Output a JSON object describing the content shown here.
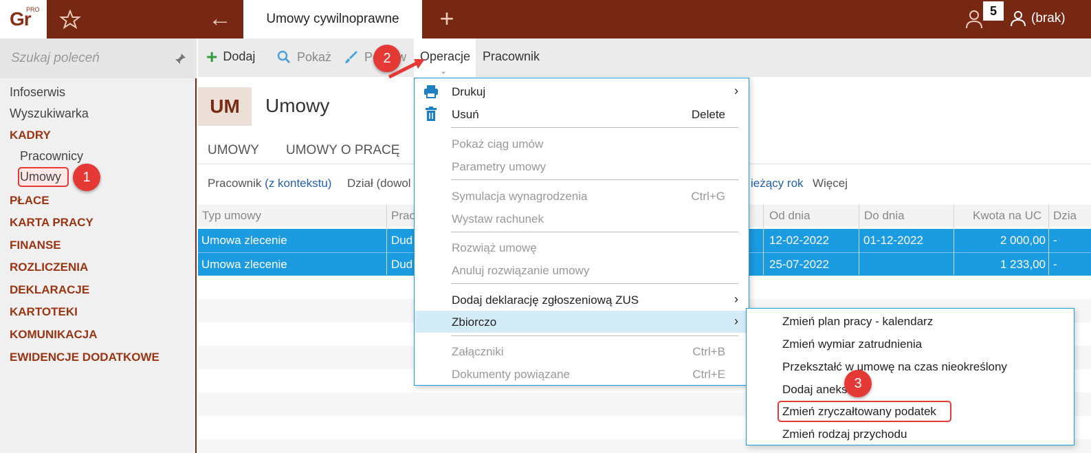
{
  "topbar": {
    "logo_text": "Gr",
    "logo_sup": "PRO",
    "active_tab": "Umowy cywilnoprawne",
    "notifications_count": "5",
    "operator": "(brak)"
  },
  "sidebar": {
    "search_placeholder": "Szukaj poleceń",
    "items": [
      {
        "label": "Infoserwis"
      },
      {
        "label": "Wyszukiwarka"
      },
      {
        "label": "KADRY"
      },
      {
        "label": "Pracownicy"
      },
      {
        "label": "Umowy"
      },
      {
        "label": "PŁACE"
      },
      {
        "label": "KARTA PRACY"
      },
      {
        "label": "FINANSE"
      },
      {
        "label": "ROZLICZENIA"
      },
      {
        "label": "DEKLARACJE"
      },
      {
        "label": "KARTOTEKI"
      },
      {
        "label": "KOMUNIKACJA"
      },
      {
        "label": "EWIDENCJE DODATKOWE"
      }
    ]
  },
  "callouts": {
    "c1": "1",
    "c2": "2",
    "c3": "3"
  },
  "toolbar": {
    "add": "Dodaj",
    "show": "Pokaż",
    "edit": "Popraw",
    "operations": "Operacje",
    "employee": "Pracownik"
  },
  "module": {
    "badge": "UM",
    "title": "Umowy"
  },
  "subtabs": [
    "UMOWY",
    "UMOWY O PRACĘ"
  ],
  "filters": {
    "employee_label": "Pracownik",
    "employee_value": "(z kontekstu)",
    "dept_label": "Dział (dowol",
    "year": "ieżący rok",
    "more": "Więcej"
  },
  "grid": {
    "headers": [
      "Typ umowy",
      "Prac",
      "Od dnia",
      "Do dnia",
      "Kwota na UC",
      "Dzia"
    ],
    "rows": [
      {
        "type": "Umowa zlecenie",
        "employee": "Dud",
        "from": "12-02-2022",
        "to": "01-12-2022",
        "amount": "2 000,00",
        "dept": "-"
      },
      {
        "type": "Umowa zlecenie",
        "employee": "Dud",
        "from": "25-07-2022",
        "to": "",
        "amount": "1 233,00",
        "dept": "-"
      }
    ]
  },
  "menu": {
    "print": "Drukuj",
    "delete": "Usuń",
    "delete_sc": "Delete",
    "chain": "Pokaż ciąg umów",
    "params": "Parametry umowy",
    "sim": "Symulacja wynagrodzenia",
    "sim_sc": "Ctrl+G",
    "invoice": "Wystaw rachunek",
    "terminate": "Rozwiąż umowę",
    "cancel_term": "Anuluj rozwiązanie umowy",
    "zus": "Dodaj deklarację zgłoszeniową ZUS",
    "bulk": "Zbiorczo",
    "attach": "Załączniki",
    "attach_sc": "Ctrl+B",
    "related": "Dokumenty powiązane",
    "related_sc": "Ctrl+E"
  },
  "submenu": {
    "items": [
      "Zmień plan pracy - kalendarz",
      "Zmień wymiar zatrudnienia",
      "Przekształć w umowę na czas nieokreślony",
      "Dodaj aneks",
      "Zmień zryczałtowany podatek",
      "Zmień rodzaj przychodu"
    ]
  },
  "colors": {
    "brand": "#772813",
    "selection": "#1b9be0",
    "callout": "#e53935"
  }
}
